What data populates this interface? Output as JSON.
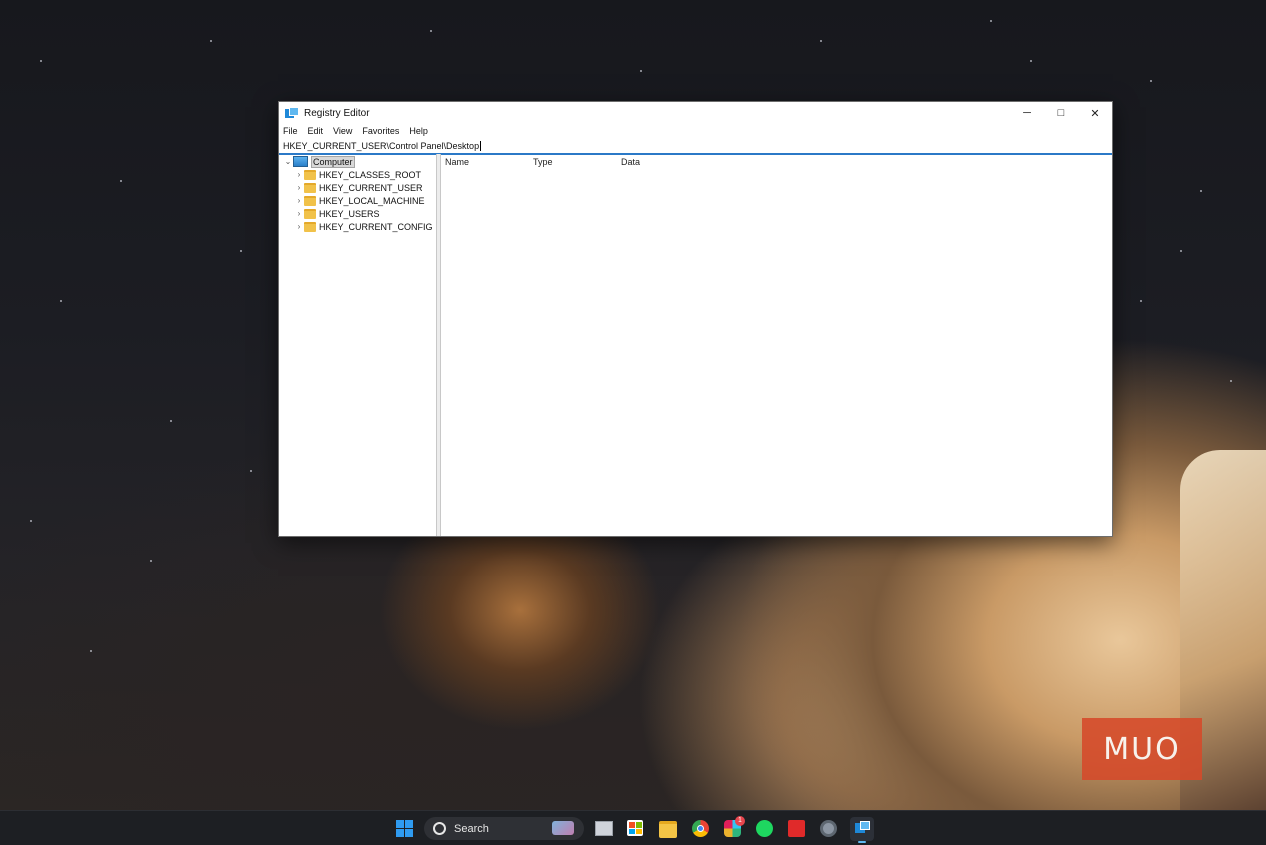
{
  "window": {
    "title": "Registry Editor",
    "controls": {
      "minimize": "─",
      "maximize": "□",
      "close": "✕"
    }
  },
  "menu": [
    {
      "label": "File"
    },
    {
      "label": "Edit"
    },
    {
      "label": "View"
    },
    {
      "label": "Favorites"
    },
    {
      "label": "Help"
    }
  ],
  "address": {
    "path": "HKEY_CURRENT_USER\\Control Panel\\Desktop"
  },
  "tree": {
    "root": {
      "label": "Computer",
      "expanded": true,
      "icon": "computer-icon"
    },
    "children": [
      {
        "label": "HKEY_CLASSES_ROOT",
        "icon": "folder-icon"
      },
      {
        "label": "HKEY_CURRENT_USER",
        "icon": "folder-icon"
      },
      {
        "label": "HKEY_LOCAL_MACHINE",
        "icon": "folder-icon"
      },
      {
        "label": "HKEY_USERS",
        "icon": "folder-icon"
      },
      {
        "label": "HKEY_CURRENT_CONFIG",
        "icon": "folder-icon"
      }
    ]
  },
  "list": {
    "columns": [
      "Name",
      "Type",
      "Data"
    ]
  },
  "taskbar": {
    "search_label": "Search",
    "apps": [
      "windows-start-icon",
      "task-view-icon",
      "microsoft-store-icon",
      "file-explorer-icon",
      "chrome-icon",
      "slack-icon",
      "spotify-icon",
      "amd-software-icon",
      "settings-icon",
      "registry-editor-icon"
    ],
    "badge": "1"
  },
  "watermark": {
    "text": "MUO"
  },
  "colors": {
    "accent": "#2b79c7",
    "taskbar_bg": "#1d1f23",
    "folder": "#f1c24a"
  }
}
